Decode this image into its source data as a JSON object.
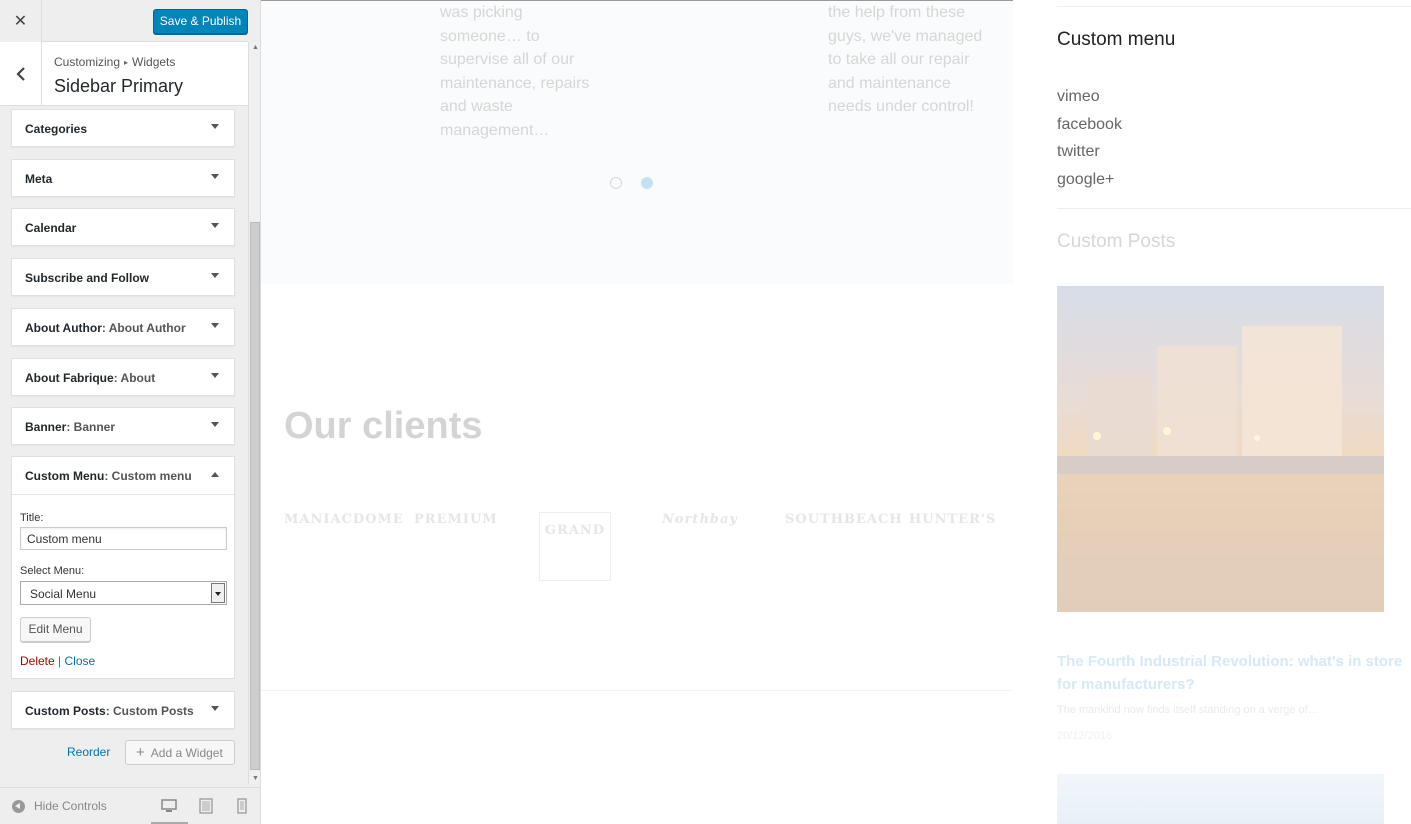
{
  "topbar": {
    "close_glyph": "✕",
    "publish_label": "Save & Publish"
  },
  "section": {
    "breadcrumb_root": "Customizing",
    "breadcrumb_sep": "▸",
    "breadcrumb_leaf": "Widgets",
    "title": "Sidebar Primary"
  },
  "widgets": [
    {
      "title": "Categories",
      "sub": ""
    },
    {
      "title": "Meta",
      "sub": ""
    },
    {
      "title": "Calendar",
      "sub": ""
    },
    {
      "title": "Subscribe and Follow",
      "sub": ""
    },
    {
      "title": "About Author",
      "sub": ": About Author"
    },
    {
      "title": "About Fabrique",
      "sub": ": About"
    },
    {
      "title": "Banner",
      "sub": ": Banner"
    }
  ],
  "open_widget": {
    "title": "Custom Menu",
    "sub": ": Custom menu",
    "title_label": "Title:",
    "title_value": "Custom menu",
    "select_label": "Select Menu:",
    "select_value": "Social Menu",
    "edit_menu_label": "Edit Menu",
    "delete_label": "Delete",
    "separator": "|",
    "close_label": "Close"
  },
  "last_widget": {
    "title": "Custom Posts",
    "sub": ": Custom Posts"
  },
  "actions": {
    "reorder_label": "Reorder",
    "add_widget_label": "Add a Widget"
  },
  "footer": {
    "hide_controls_label": "Hide Controls",
    "devices": [
      "desktop-icon",
      "tablet-icon",
      "mobile-icon"
    ]
  },
  "preview": {
    "testimonial_left": "was picking\nsomeone… to\nsupervise all of our\nmaintenance, repairs\nand waste\nmanagement…",
    "testimonial_right": "the help from these\nguys, we've managed\nto take all our repair\nand maintenance\nneeds under control!",
    "clients_title": "Our clients",
    "client_logos": [
      "MANIACDOME",
      "PREMIUM",
      "GRAND",
      "Northbay",
      "SOUTHBEACH",
      "HUNTER'S"
    ],
    "sidebar": {
      "custom_menu_title": "Custom menu",
      "menu_links": [
        "vimeo",
        "facebook",
        "twitter",
        "google+"
      ],
      "custom_posts_title": "Custom Posts",
      "post_title": "The Fourth Industrial Revolution: what's in store for manufacturers?",
      "post_excerpt": "The mankind now finds itself standing on a verge of…",
      "post_date": "20/12/2016"
    }
  },
  "colors": {
    "accent": "#0085ba",
    "link": "#0073aa",
    "delete": "#a00000",
    "panel_bg": "#eeeeee"
  }
}
